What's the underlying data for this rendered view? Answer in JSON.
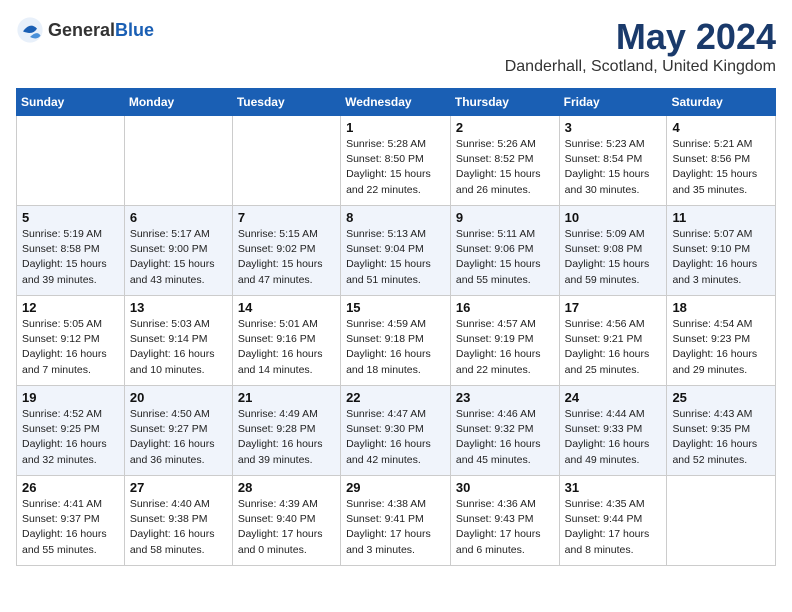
{
  "header": {
    "logo_general": "General",
    "logo_blue": "Blue",
    "title": "May 2024",
    "subtitle": "Danderhall, Scotland, United Kingdom"
  },
  "days_of_week": [
    "Sunday",
    "Monday",
    "Tuesday",
    "Wednesday",
    "Thursday",
    "Friday",
    "Saturday"
  ],
  "weeks": [
    {
      "shaded": false,
      "days": [
        {
          "num": "",
          "info": ""
        },
        {
          "num": "",
          "info": ""
        },
        {
          "num": "",
          "info": ""
        },
        {
          "num": "1",
          "info": "Sunrise: 5:28 AM\nSunset: 8:50 PM\nDaylight: 15 hours\nand 22 minutes."
        },
        {
          "num": "2",
          "info": "Sunrise: 5:26 AM\nSunset: 8:52 PM\nDaylight: 15 hours\nand 26 minutes."
        },
        {
          "num": "3",
          "info": "Sunrise: 5:23 AM\nSunset: 8:54 PM\nDaylight: 15 hours\nand 30 minutes."
        },
        {
          "num": "4",
          "info": "Sunrise: 5:21 AM\nSunset: 8:56 PM\nDaylight: 15 hours\nand 35 minutes."
        }
      ]
    },
    {
      "shaded": true,
      "days": [
        {
          "num": "5",
          "info": "Sunrise: 5:19 AM\nSunset: 8:58 PM\nDaylight: 15 hours\nand 39 minutes."
        },
        {
          "num": "6",
          "info": "Sunrise: 5:17 AM\nSunset: 9:00 PM\nDaylight: 15 hours\nand 43 minutes."
        },
        {
          "num": "7",
          "info": "Sunrise: 5:15 AM\nSunset: 9:02 PM\nDaylight: 15 hours\nand 47 minutes."
        },
        {
          "num": "8",
          "info": "Sunrise: 5:13 AM\nSunset: 9:04 PM\nDaylight: 15 hours\nand 51 minutes."
        },
        {
          "num": "9",
          "info": "Sunrise: 5:11 AM\nSunset: 9:06 PM\nDaylight: 15 hours\nand 55 minutes."
        },
        {
          "num": "10",
          "info": "Sunrise: 5:09 AM\nSunset: 9:08 PM\nDaylight: 15 hours\nand 59 minutes."
        },
        {
          "num": "11",
          "info": "Sunrise: 5:07 AM\nSunset: 9:10 PM\nDaylight: 16 hours\nand 3 minutes."
        }
      ]
    },
    {
      "shaded": false,
      "days": [
        {
          "num": "12",
          "info": "Sunrise: 5:05 AM\nSunset: 9:12 PM\nDaylight: 16 hours\nand 7 minutes."
        },
        {
          "num": "13",
          "info": "Sunrise: 5:03 AM\nSunset: 9:14 PM\nDaylight: 16 hours\nand 10 minutes."
        },
        {
          "num": "14",
          "info": "Sunrise: 5:01 AM\nSunset: 9:16 PM\nDaylight: 16 hours\nand 14 minutes."
        },
        {
          "num": "15",
          "info": "Sunrise: 4:59 AM\nSunset: 9:18 PM\nDaylight: 16 hours\nand 18 minutes."
        },
        {
          "num": "16",
          "info": "Sunrise: 4:57 AM\nSunset: 9:19 PM\nDaylight: 16 hours\nand 22 minutes."
        },
        {
          "num": "17",
          "info": "Sunrise: 4:56 AM\nSunset: 9:21 PM\nDaylight: 16 hours\nand 25 minutes."
        },
        {
          "num": "18",
          "info": "Sunrise: 4:54 AM\nSunset: 9:23 PM\nDaylight: 16 hours\nand 29 minutes."
        }
      ]
    },
    {
      "shaded": true,
      "days": [
        {
          "num": "19",
          "info": "Sunrise: 4:52 AM\nSunset: 9:25 PM\nDaylight: 16 hours\nand 32 minutes."
        },
        {
          "num": "20",
          "info": "Sunrise: 4:50 AM\nSunset: 9:27 PM\nDaylight: 16 hours\nand 36 minutes."
        },
        {
          "num": "21",
          "info": "Sunrise: 4:49 AM\nSunset: 9:28 PM\nDaylight: 16 hours\nand 39 minutes."
        },
        {
          "num": "22",
          "info": "Sunrise: 4:47 AM\nSunset: 9:30 PM\nDaylight: 16 hours\nand 42 minutes."
        },
        {
          "num": "23",
          "info": "Sunrise: 4:46 AM\nSunset: 9:32 PM\nDaylight: 16 hours\nand 45 minutes."
        },
        {
          "num": "24",
          "info": "Sunrise: 4:44 AM\nSunset: 9:33 PM\nDaylight: 16 hours\nand 49 minutes."
        },
        {
          "num": "25",
          "info": "Sunrise: 4:43 AM\nSunset: 9:35 PM\nDaylight: 16 hours\nand 52 minutes."
        }
      ]
    },
    {
      "shaded": false,
      "days": [
        {
          "num": "26",
          "info": "Sunrise: 4:41 AM\nSunset: 9:37 PM\nDaylight: 16 hours\nand 55 minutes."
        },
        {
          "num": "27",
          "info": "Sunrise: 4:40 AM\nSunset: 9:38 PM\nDaylight: 16 hours\nand 58 minutes."
        },
        {
          "num": "28",
          "info": "Sunrise: 4:39 AM\nSunset: 9:40 PM\nDaylight: 17 hours\nand 0 minutes."
        },
        {
          "num": "29",
          "info": "Sunrise: 4:38 AM\nSunset: 9:41 PM\nDaylight: 17 hours\nand 3 minutes."
        },
        {
          "num": "30",
          "info": "Sunrise: 4:36 AM\nSunset: 9:43 PM\nDaylight: 17 hours\nand 6 minutes."
        },
        {
          "num": "31",
          "info": "Sunrise: 4:35 AM\nSunset: 9:44 PM\nDaylight: 17 hours\nand 8 minutes."
        },
        {
          "num": "",
          "info": ""
        }
      ]
    }
  ]
}
